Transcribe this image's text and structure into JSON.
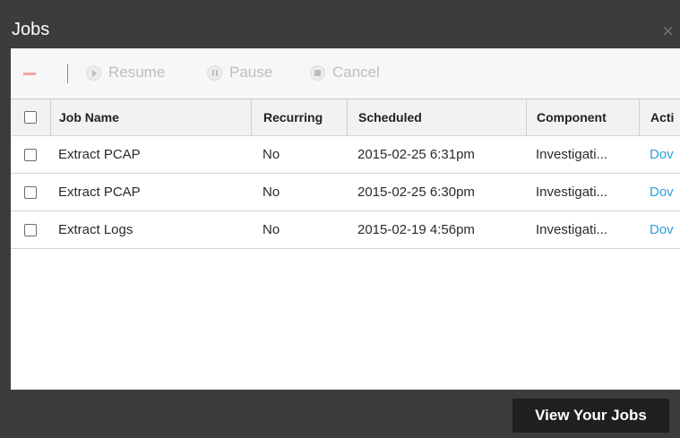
{
  "window": {
    "title": "Jobs",
    "close_icon": "×"
  },
  "toolbar": {
    "remove_icon": "minus-icon",
    "resume_label": "Resume",
    "pause_label": "Pause",
    "cancel_label": "Cancel"
  },
  "table": {
    "columns": [
      "Job Name",
      "Recurring",
      "Scheduled",
      "Component",
      "Acti"
    ],
    "rows": [
      {
        "job_name": "Extract PCAP",
        "recurring": "No",
        "scheduled": "2015-02-25 6:31pm",
        "component": "Investigati...",
        "action": "Dov"
      },
      {
        "job_name": "Extract PCAP",
        "recurring": "No",
        "scheduled": "2015-02-25 6:30pm",
        "component": "Investigati...",
        "action": "Dov"
      },
      {
        "job_name": "Extract Logs",
        "recurring": "No",
        "scheduled": "2015-02-19 4:56pm",
        "component": "Investigati...",
        "action": "Dov"
      }
    ]
  },
  "footer": {
    "view_jobs_label": "View Your Jobs"
  },
  "colors": {
    "dark_frame": "#3c3c3c",
    "link": "#2d9fd9",
    "button_dark": "#1f1f1f"
  }
}
